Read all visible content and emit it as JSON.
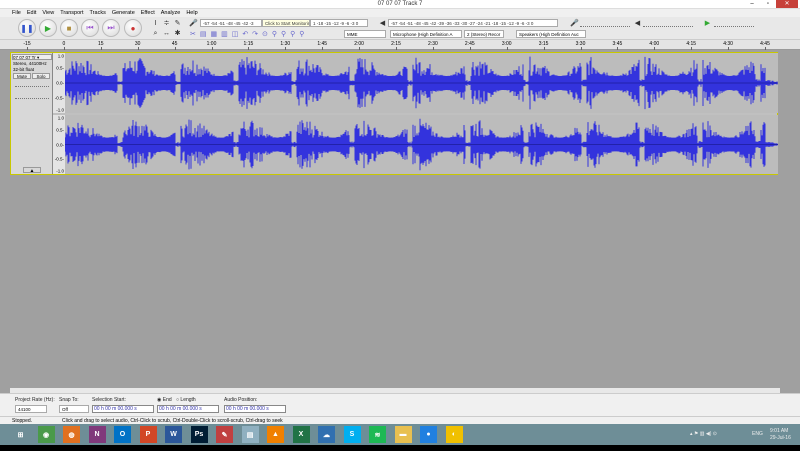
{
  "window": {
    "title": "07 07 07 Track 7",
    "minimize": "–",
    "maximize": "▫",
    "close": "✕"
  },
  "menu": [
    "File",
    "Edit",
    "View",
    "Transport",
    "Tracks",
    "Generate",
    "Effect",
    "Analyze",
    "Help"
  ],
  "transport": {
    "pause": "❚❚",
    "play": "▶",
    "stop": "■",
    "skip_start": "⏮",
    "skip_end": "⏭",
    "record": "●"
  },
  "meters": {
    "record_scale": "-57 -54 -51 -48 -45 -42 -3",
    "record_tooltip": "Click to Start Monitoring",
    "record_scale_tail": "1 -18 -15 -12 -9 -6 -3 0",
    "playback_scale": "-57 -54 -51 -48 -45 -42 -39 -36 -33 -30 -27 -24 -21 -18 -15 -12 -9 -6 -3 0"
  },
  "devices": {
    "host": "MME",
    "mic": "Microphone (High Definition A",
    "channels": "2 (Stereo) Recor",
    "speakers": "Speakers (High Definition Auc"
  },
  "ruler": {
    "labels": [
      "-15",
      "0",
      "15",
      "30",
      "45",
      "1:00",
      "1:15",
      "1:30",
      "1:45",
      "2:00",
      "2:15",
      "2:30",
      "2:45",
      "3:00",
      "3:15",
      "3:30",
      "3:45",
      "4:00",
      "4:15",
      "4:30",
      "4:45"
    ]
  },
  "track": {
    "name": "07 07 07 Tr",
    "info1": "Stereo, 44100Hz",
    "info2": "32-bit float",
    "mute": "Mute",
    "solo": "Solo",
    "gain_minus": "-",
    "gain_plus": "+",
    "pan_l": "L",
    "pan_r": "R",
    "collapse": "▲",
    "vscale": [
      "1.0",
      "0.5-",
      "0.0-",
      "-0.5-",
      "-1.0"
    ],
    "wave_color": "#3333dd"
  },
  "selection": {
    "rate_label": "Project Rate (Hz):",
    "rate": "44100",
    "snap_label": "Snap To:",
    "snap": "Off",
    "start_label": "Selection Start:",
    "end_label": "End",
    "length_label": "Length",
    "pos_label": "Audio Position:",
    "start": "00 h 00 m 00.000 s",
    "end": "00 h 00 m 00.000 s",
    "pos": "00 h 00 m 00.000 s"
  },
  "status": {
    "state": "Stopped.",
    "hint": "Click and drag to select audio, Ctrl-Click to scrub, Ctrl-Double-Click to scroll-scrub, Ctrl-drag to seek"
  },
  "taskbar": {
    "apps": [
      {
        "name": "windows",
        "label": "⊞",
        "color": "#6e8e97"
      },
      {
        "name": "chrome",
        "label": "◉",
        "color": "#4a9a4a"
      },
      {
        "name": "firefox",
        "label": "◍",
        "color": "#e07020"
      },
      {
        "name": "onenote",
        "label": "N",
        "color": "#80397b"
      },
      {
        "name": "outlook",
        "label": "O",
        "color": "#0072c6"
      },
      {
        "name": "powerpoint",
        "label": "P",
        "color": "#d24726"
      },
      {
        "name": "word",
        "label": "W",
        "color": "#2b579a"
      },
      {
        "name": "photoshop",
        "label": "Ps",
        "color": "#001d34"
      },
      {
        "name": "paint",
        "label": "✎",
        "color": "#c04040"
      },
      {
        "name": "notepad",
        "label": "▤",
        "color": "#8fb0c0"
      },
      {
        "name": "vlc",
        "label": "▲",
        "color": "#f08000"
      },
      {
        "name": "excel",
        "label": "X",
        "color": "#217346"
      },
      {
        "name": "network",
        "label": "☁",
        "color": "#3070b0"
      },
      {
        "name": "skype",
        "label": "S",
        "color": "#00aff0"
      },
      {
        "name": "spotify",
        "label": "≋",
        "color": "#1db954"
      },
      {
        "name": "explorer",
        "label": "▬",
        "color": "#e8c050"
      },
      {
        "name": "camera",
        "label": "●",
        "color": "#2080e0"
      },
      {
        "name": "audacity",
        "label": "◐",
        "color": "#f0c000"
      }
    ],
    "lang": "ENG",
    "time": "9:01 AM",
    "date": "29-Jul-16"
  }
}
